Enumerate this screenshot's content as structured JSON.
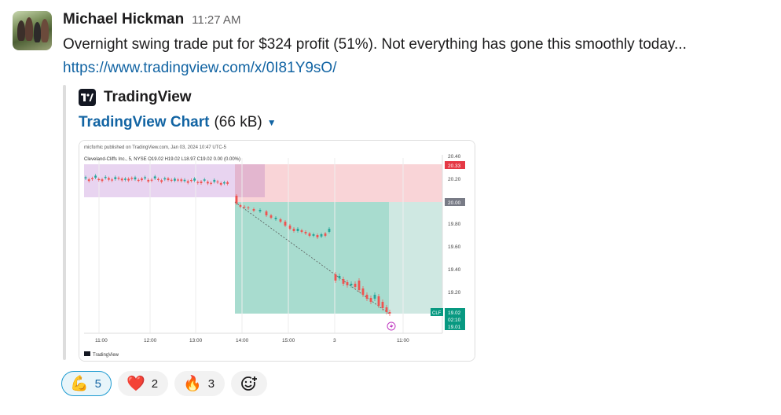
{
  "message": {
    "sender": "Michael Hickman",
    "time": "11:27 AM",
    "text": "Overnight swing trade put for $324 profit (51%). Not everything has gone this smoothly today...",
    "link": "https://www.tradingview.com/x/0I81Y9sO/"
  },
  "unfurl": {
    "source_name": "TradingView",
    "title": "TradingView Chart",
    "size": "(66 kB)",
    "icon": "tradingview-logo"
  },
  "chart": {
    "published_line": "micforhic published on TradingView.com, Jan 03, 2024 10:47 UTC-5",
    "ohlc_line": "Cleveland-Cliffs Inc., 5, NYSE O19.02 H19.02 L18.97 C19.02 0.00 (0.00%)",
    "footer_brand": "TradingView",
    "price_labels": [
      "20.40",
      "20.20",
      "19.80",
      "19.60",
      "19.40",
      "19.20"
    ],
    "badge_stop": "20.33",
    "badge_entry": "20.00",
    "badge_ticker": "CLF",
    "badge_price": "19.02",
    "badge_countdown": "02:10",
    "badge_target": "19.01",
    "time_labels": [
      "11:00",
      "12:00",
      "13:00",
      "14:00",
      "15:00",
      "3",
      "11:00"
    ],
    "colors": {
      "up": "#26a69a",
      "down": "#ef5350",
      "stop_zone": "#f9d4d7",
      "target_zone": "#cfe8e2",
      "prior_band": "#e8d4f0"
    }
  },
  "reactions": [
    {
      "emoji": "💪",
      "name": "flexed-biceps",
      "count": "5",
      "active": true
    },
    {
      "emoji": "❤️",
      "name": "red-heart",
      "count": "2",
      "active": false
    },
    {
      "emoji": "🔥",
      "name": "fire",
      "count": "3",
      "active": false
    }
  ],
  "add_reaction_icon": "add-emoji-icon"
}
